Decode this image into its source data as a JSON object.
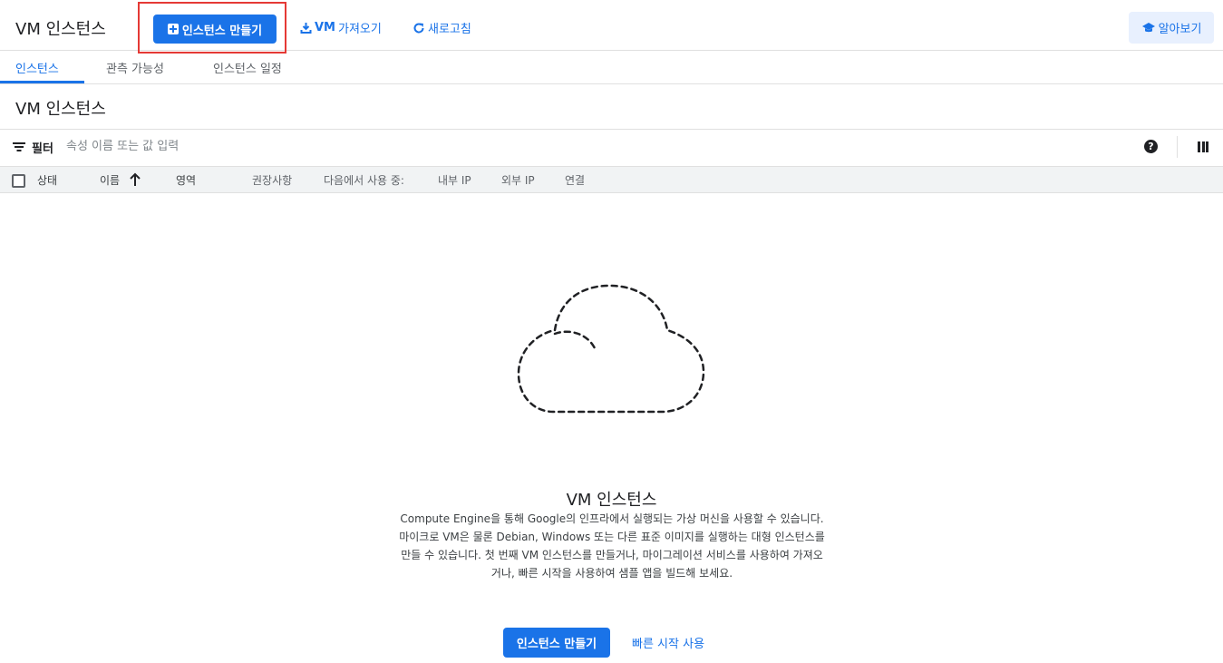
{
  "header": {
    "title": "VM 인스턴스",
    "create_button": "인스턴스 만들기",
    "import_button_bold": "VM",
    "import_button_rest": " 가져오기",
    "refresh_button": "새로고침",
    "learn_button": "알아보기"
  },
  "tabs": [
    {
      "label": "인스턴스",
      "active": true
    },
    {
      "label": "관측 가능성",
      "active": false
    },
    {
      "label": "인스턴스 일정",
      "active": false
    }
  ],
  "section_title": "VM 인스턴스",
  "filter": {
    "label": "필터",
    "placeholder": "속성 이름 또는 값 입력"
  },
  "table": {
    "columns": [
      "상태",
      "이름",
      "영역",
      "권장사항",
      "다음에서 사용 중:",
      "내부 IP",
      "외부 IP",
      "연결"
    ],
    "sort_column": "이름",
    "sort_direction": "ascending"
  },
  "empty_state": {
    "title": "VM 인스턴스",
    "description": "Compute Engine을 통해 Google의 인프라에서 실행되는 가상 머신을 사용할 수 있습니다. 마이크로 VM은 물론 Debian, Windows 또는 다른 표준 이미지를 실행하는 대형 인스턴스를 만들 수 있습니다. 첫 번째 VM 인스턴스를 만들거나, 마이그레이션 서비스를 사용하여 가져오거나, 빠른 시작을 사용하여 샘플 앱을 빌드해 보세요.",
    "create_button": "인스턴스 만들기",
    "quickstart_link": "빠른 시작 사용"
  },
  "colors": {
    "accent": "#1a73e8",
    "highlight": "#e53935"
  },
  "icons": [
    "plus-box-icon",
    "download-icon",
    "refresh-icon",
    "school-icon",
    "filter-icon",
    "help-icon",
    "columns-icon",
    "arrow-up-icon",
    "cloud-icon"
  ]
}
